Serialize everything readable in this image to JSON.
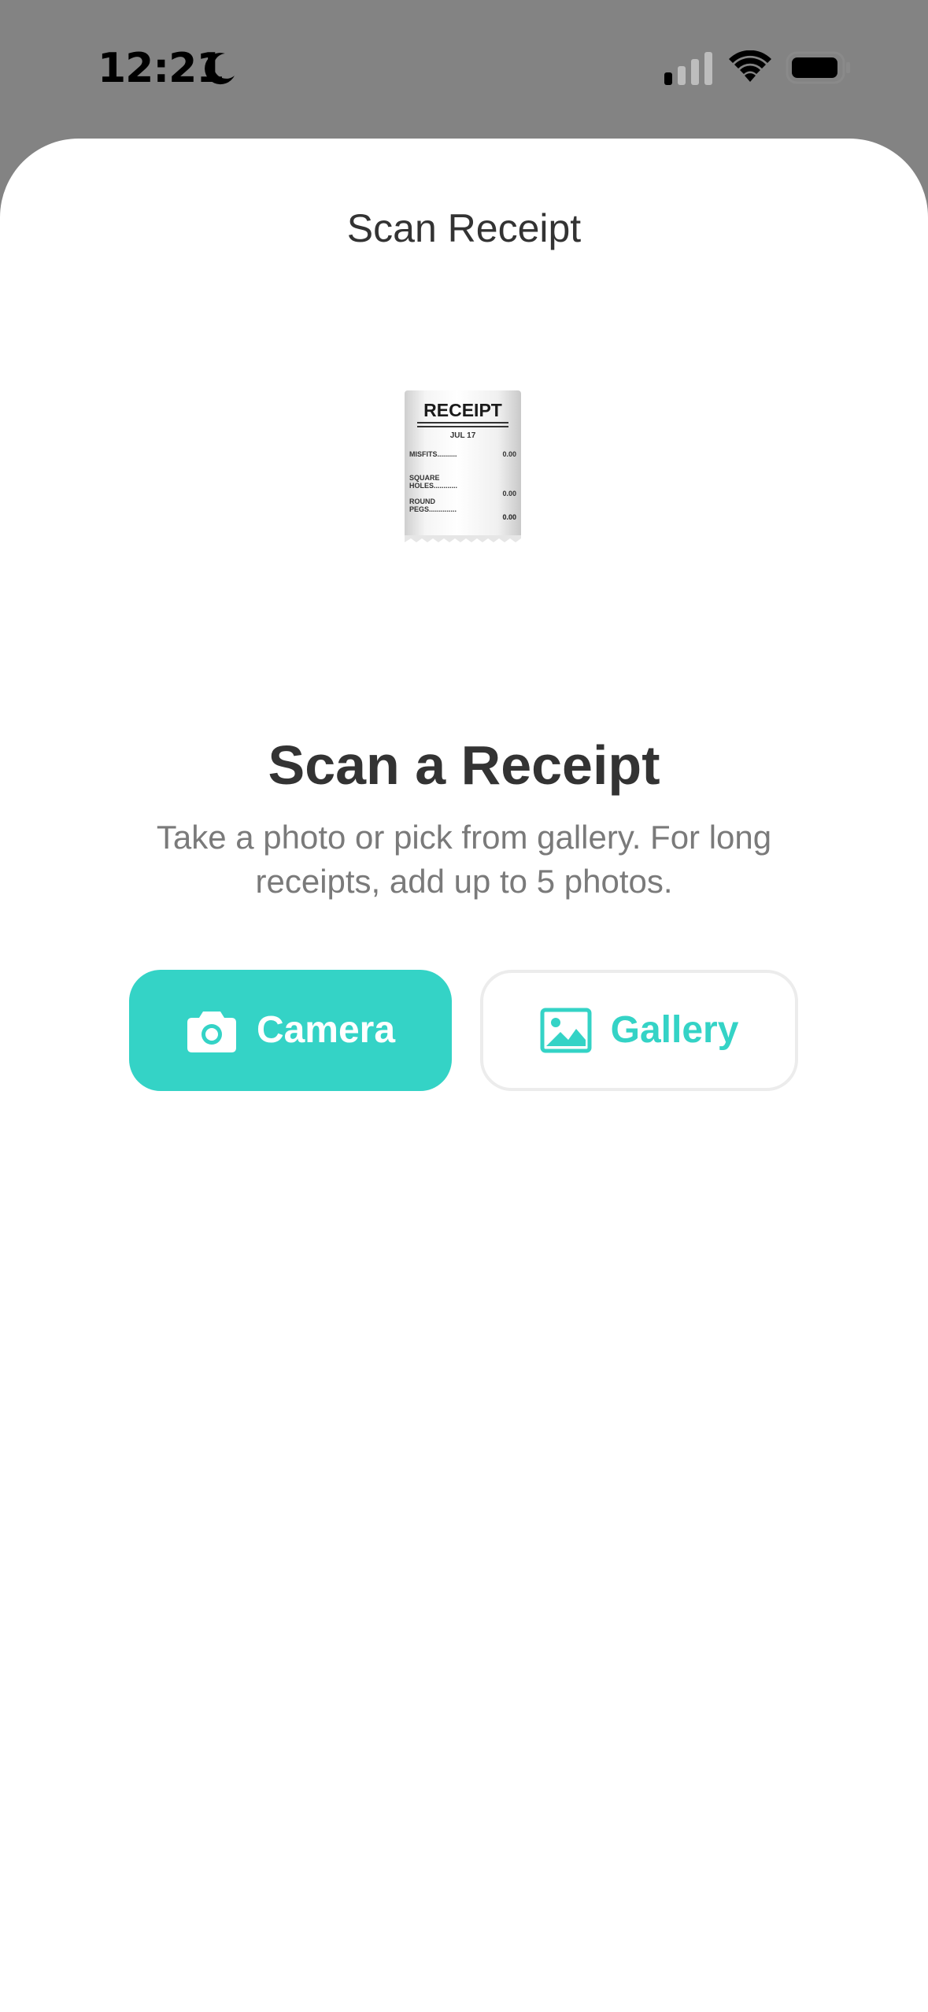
{
  "status_bar": {
    "time": "12:21",
    "moon_icon": "moon-icon",
    "signal_icon": "cellular-signal-icon",
    "wifi_icon": "wifi-icon",
    "battery_icon": "battery-icon"
  },
  "sheet": {
    "title": "Scan Receipt"
  },
  "illustration": {
    "icon": "receipt-icon",
    "heading": "RECEIPT",
    "date": "JUL 17",
    "lines": [
      {
        "label": "MISFITS..........",
        "amount": "0.00"
      },
      {
        "label": "SQUARE\nHOLES............",
        "amount": "0.00"
      },
      {
        "label": "ROUND\nPEGS..............",
        "amount": "0.00"
      },
      {
        "label": "",
        "amount": "0.00"
      }
    ]
  },
  "main": {
    "heading": "Scan a Receipt",
    "description": "Take a photo or pick from gallery. For long receipts, add up to 5 photos."
  },
  "buttons": {
    "camera": {
      "label": "Camera",
      "icon": "camera-icon"
    },
    "gallery": {
      "label": "Gallery",
      "icon": "image-icon"
    }
  },
  "colors": {
    "accent": "#34d3c6",
    "backdrop": "#838383",
    "text_primary": "#333333",
    "text_secondary": "#7a7a7a"
  }
}
